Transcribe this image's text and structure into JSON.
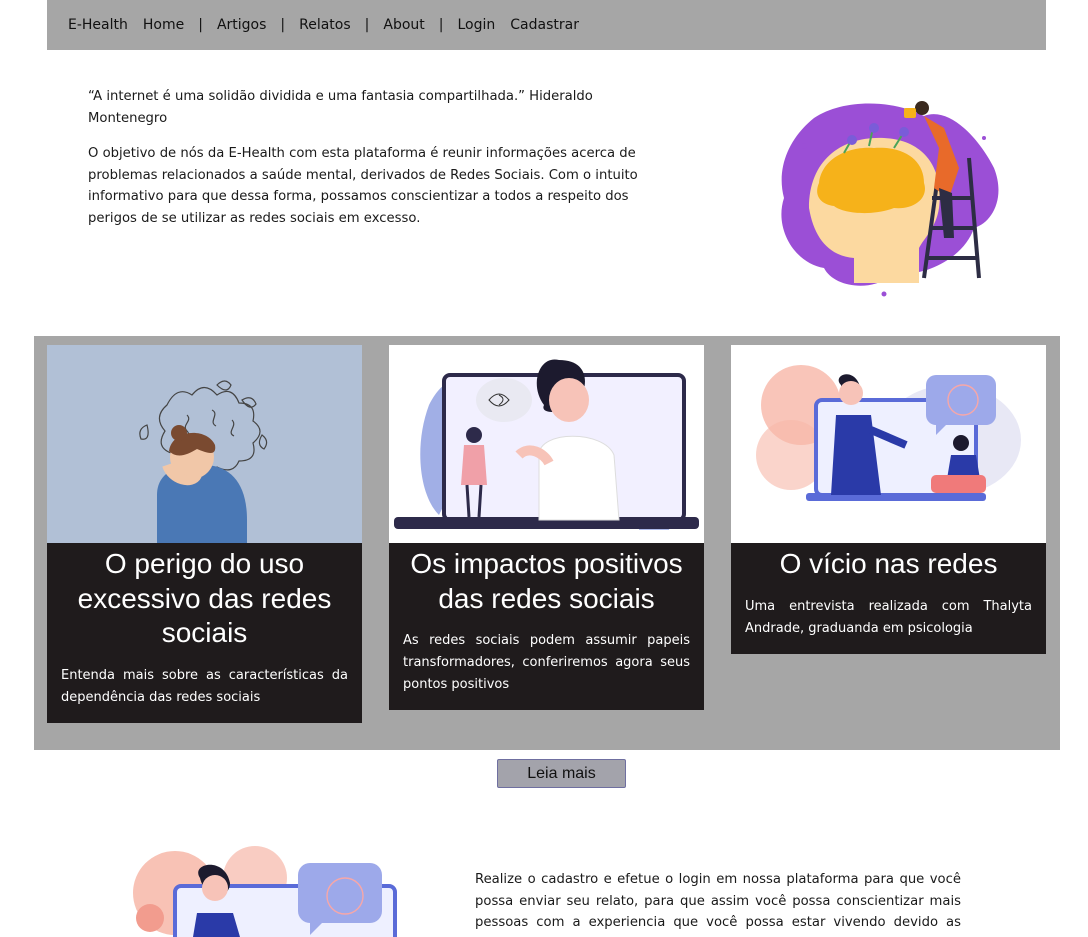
{
  "nav": {
    "brand": "E-Health",
    "items": [
      "Home",
      "Artigos",
      "Relatos",
      "About",
      "Login",
      "Cadastrar"
    ],
    "separator": "|"
  },
  "intro": {
    "quote": "“A internet é uma solidão dividida e uma fantasia compartilhada.” Hideraldo Montenegro",
    "paragraph": "O objetivo de nós da E-Health com esta plataforma é reunir informações acerca de problemas relacionados a saúde mental, derivados de Redes Sociais. Com o intuito informativo para que dessa forma, possamos conscientizar a todos a respeito dos perigos de se utilizar as redes sociais em excesso."
  },
  "cards": [
    {
      "title": "O perigo do uso excessivo das redes sociais",
      "text": "Entenda mais sobre as características da dependência das redes sociais",
      "image": "stressed-person-illustration"
    },
    {
      "title": "Os impactos positivos das redes sociais",
      "text": "As redes sociais podem assumir papeis transformadores, conferiremos agora seus pontos positivos",
      "image": "video-call-illustration"
    },
    {
      "title": "O vício nas redes",
      "text": "Uma entrevista realizada com Thalyta Andrade, graduanda em psicologia",
      "image": "online-therapy-illustration"
    }
  ],
  "more_button": "Leia mais",
  "bottom": {
    "text": "Realize o cadastro e efetue o login em nossa plataforma para que você possa enviar seu relato, para que assim você possa conscientizar mais pessoas com a experiencia que você possa estar vivendo devido as redes"
  },
  "colors": {
    "nav_bg": "#a6a6a6",
    "band_bg": "#a6a6a6",
    "card_bg": "#1f1b1c",
    "button_bg": "#a3a3ab",
    "accent_purple": "#9b4fd6"
  }
}
